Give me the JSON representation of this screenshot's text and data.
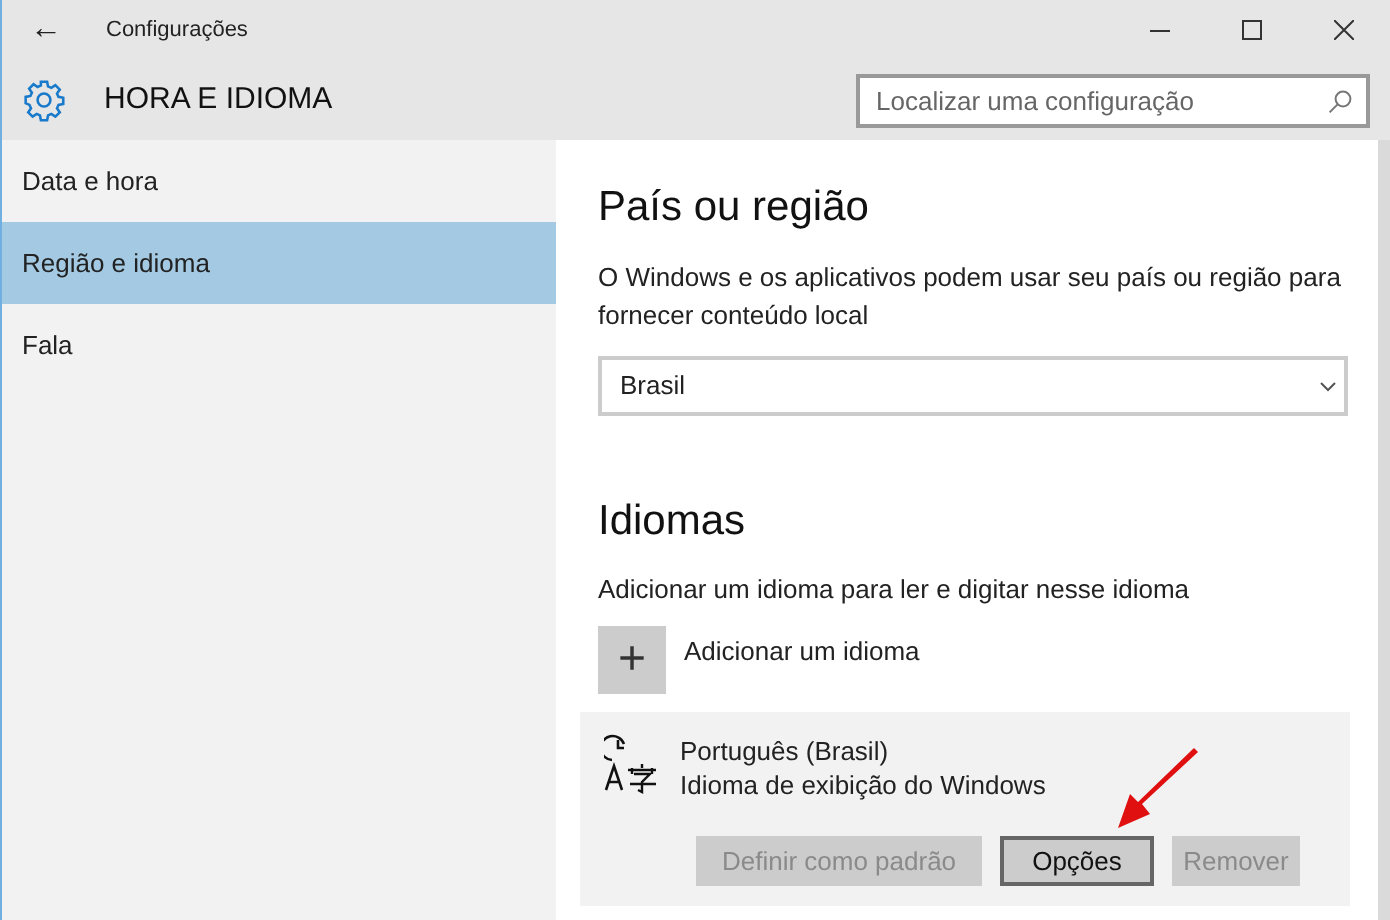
{
  "window": {
    "title": "Configurações",
    "back": "←"
  },
  "header": {
    "title": "HORA E IDIOMA",
    "search": {
      "placeholder": "Localizar uma configuração"
    }
  },
  "sidebar": {
    "items": [
      {
        "label": "Data e hora",
        "selected": false
      },
      {
        "label": "Região e idioma",
        "selected": true
      },
      {
        "label": "Fala",
        "selected": false
      }
    ]
  },
  "region": {
    "title": "País ou região",
    "description": "O Windows e os aplicativos podem usar seu país ou região para fornecer conteúdo local",
    "dropdown": {
      "value": "Brasil"
    }
  },
  "languages": {
    "title": "Idiomas",
    "description": "Adicionar um idioma para ler e digitar nesse idioma",
    "add": {
      "icon": "+",
      "label": "Adicionar um idioma"
    },
    "items": [
      {
        "name": "Português (Brasil)",
        "subtitle": "Idioma de exibição do Windows",
        "expanded": true,
        "buttons": [
          {
            "label": "Definir como padrão",
            "disabled": true
          },
          {
            "label": "Opções",
            "disabled": false
          },
          {
            "label": "Remover",
            "disabled": true
          }
        ]
      }
    ]
  }
}
